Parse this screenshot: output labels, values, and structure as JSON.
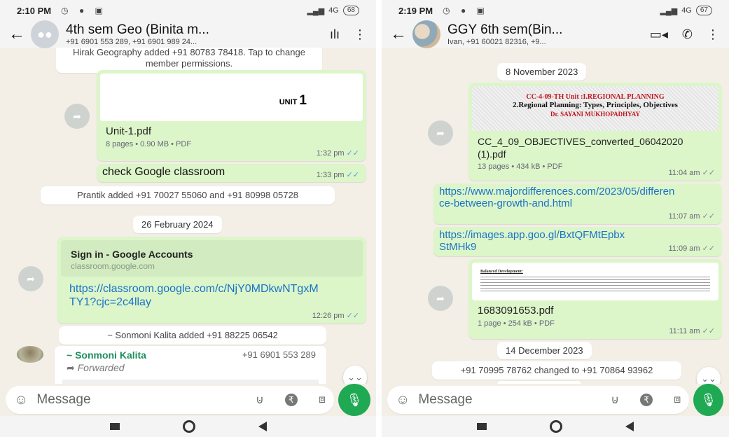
{
  "left": {
    "status": {
      "time": "2:10 PM",
      "battery": "68",
      "network": "4G"
    },
    "header": {
      "title": "4th sem  Geo (Binita m...",
      "subtitle": "+91 6901 553 289, +91 6901 989 24..."
    },
    "messages": {
      "perm_notice": "Hirak Geography added +91 80783 78418. Tap to change member permissions.",
      "pdf1": {
        "preview_label": "UNIT",
        "preview_num": "1",
        "name": "Unit-1.pdf",
        "meta": "8 pages • 0.90 MB • PDF",
        "time": "1:32 pm"
      },
      "text1": {
        "text": "check Google classroom",
        "time": "1:33 pm"
      },
      "sys_added": "Prantik added +91 70027 55060 and +91 80998 05728",
      "date1": "26 February 2024",
      "link1": {
        "title": "Sign in - Google Accounts",
        "domain": "classroom.google.com",
        "url": "https://classroom.google.com/c/NjY0MDkwNTgxMTY1?cjc=2c4llay",
        "time": "12:26 pm"
      },
      "sys_added2": "~ Sonmoni Kalita added +91 88225 06542",
      "incoming": {
        "sender": "~ Sonmoni Kalita",
        "phone": "+91 6901 553 289",
        "forwarded": "Forwarded"
      }
    },
    "input": {
      "placeholder": "Message"
    }
  },
  "right": {
    "status": {
      "time": "2:19 PM",
      "battery": "67",
      "network": "4G"
    },
    "header": {
      "title": "GGY 6th sem(Bin...",
      "subtitle": "Ivan, +91 60021 82316, +9..."
    },
    "messages": {
      "date1": "8 November 2023",
      "pdf1": {
        "preview_line1": "CC-4-09-TH Unit :I.REGIONAL PLANNING",
        "preview_line2": "2.Regional Planning: Types, Principles, Objectives",
        "preview_line3": "Dr. SAYANI MUKHOPADHYAY",
        "name": "CC_4_09_OBJECTIVES_converted_06042020 (1).pdf",
        "meta": "13 pages • 434 kB • PDF",
        "time": "11:04 am"
      },
      "link1": {
        "url": "https://www.majordifferences.com/2023/05/difference-between-growth-and.html",
        "time": "11:07 am"
      },
      "link2": {
        "url": "https://images.app.goo.gl/BxtQFMtEpbxStMHk9",
        "time": "11:09 am"
      },
      "pdf2": {
        "preview_title": "Balanced Development:",
        "name": "1683091653.pdf",
        "meta": "1 page • 254 kB • PDF",
        "time": "11:11 am"
      },
      "date2": "14 December 2023",
      "sys_changed": "+91 70995 78762 changed to +91 70864 93962"
    },
    "input": {
      "placeholder": "Message"
    }
  }
}
